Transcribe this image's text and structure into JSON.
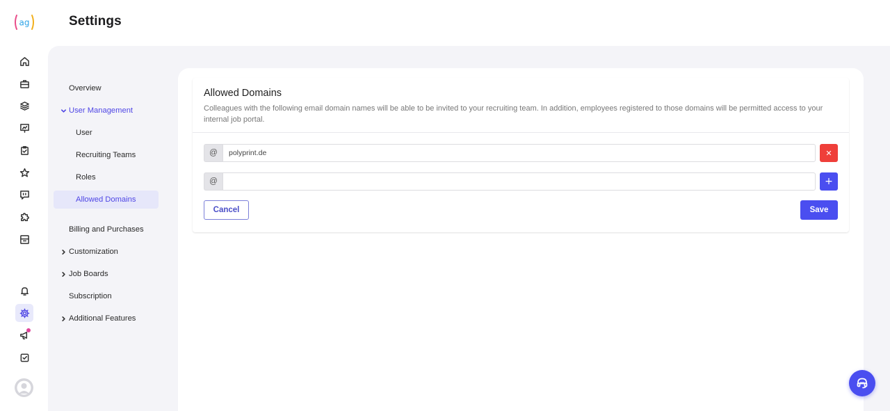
{
  "app": {
    "logo_text": "ag",
    "page_title": "Settings"
  },
  "rail": {
    "icons": [
      "home-icon",
      "briefcase-icon",
      "layers-icon",
      "presentation-icon",
      "clipboard-check-icon",
      "star-icon",
      "chat-quote-icon",
      "puzzle-icon",
      "archive-icon",
      "bell-icon",
      "gear-icon",
      "megaphone-icon",
      "checkbox-icon",
      "avatar-icon"
    ],
    "active": "gear-icon",
    "notification_dot_color": "#e0459b"
  },
  "subnav": {
    "items": [
      {
        "label": "Overview"
      },
      {
        "label": "User Management"
      },
      {
        "label": "User"
      },
      {
        "label": "Recruiting Teams"
      },
      {
        "label": "Roles"
      },
      {
        "label": "Allowed Domains"
      },
      {
        "label": "Billing and Purchases"
      },
      {
        "label": "Customization"
      },
      {
        "label": "Job Boards"
      },
      {
        "label": "Subscription"
      },
      {
        "label": "Additional Features"
      }
    ],
    "selected": "Allowed Domains"
  },
  "card": {
    "title": "Allowed Domains",
    "description": "Colleagues with the following email domain names will be able to be invited to your recruiting team. In addition, employees registered to those domains will be permitted access to your internal job portal.",
    "at_symbol": "@",
    "domains": [
      {
        "value": "polyprint.de",
        "action_symbol": "✕"
      },
      {
        "value": "",
        "action_symbol": "+"
      }
    ],
    "cancel_label": "Cancel",
    "save_label": "Save"
  },
  "colors": {
    "accent": "#4a4ef0",
    "danger": "#ef3f3a",
    "content_bg": "#f4f4f8"
  }
}
